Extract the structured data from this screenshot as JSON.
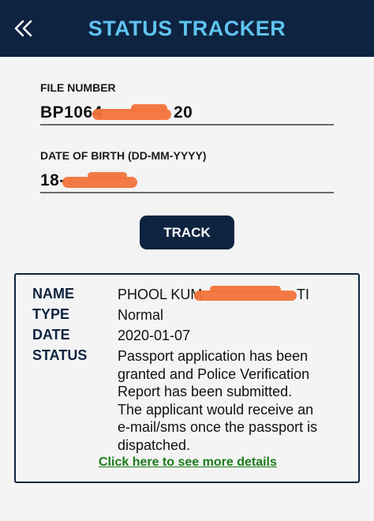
{
  "header": {
    "title": "STATUS TRACKER",
    "back_icon": "double-chevron-left-icon"
  },
  "form": {
    "file_number_label": "FILE NUMBER",
    "file_number_value_start": "BP1064",
    "file_number_value_end": "20",
    "dob_label": "DATE OF BIRTH (DD-MM-YYYY)",
    "dob_value_start": "18-",
    "track_label": "TRACK"
  },
  "result": {
    "name_label": "NAME",
    "name_value_start": "PHOOL KUM",
    "name_value_end": "TI",
    "type_label": "TYPE",
    "type_value": "Normal",
    "date_label": "DATE",
    "date_value": "2020-01-07",
    "status_label": "STATUS",
    "status_lines": [
      "Passport application has been",
      "granted and Police Verification",
      "Report has been submitted.",
      "The applicant would receive an",
      "e-mail/sms once the passport is",
      "dispatched."
    ],
    "details_link": "Click here to see more details"
  },
  "colors": {
    "header_bg": "#0e2340",
    "header_title": "#5fc3ef",
    "link": "#1a7a1a",
    "redaction": "#f2733a"
  }
}
